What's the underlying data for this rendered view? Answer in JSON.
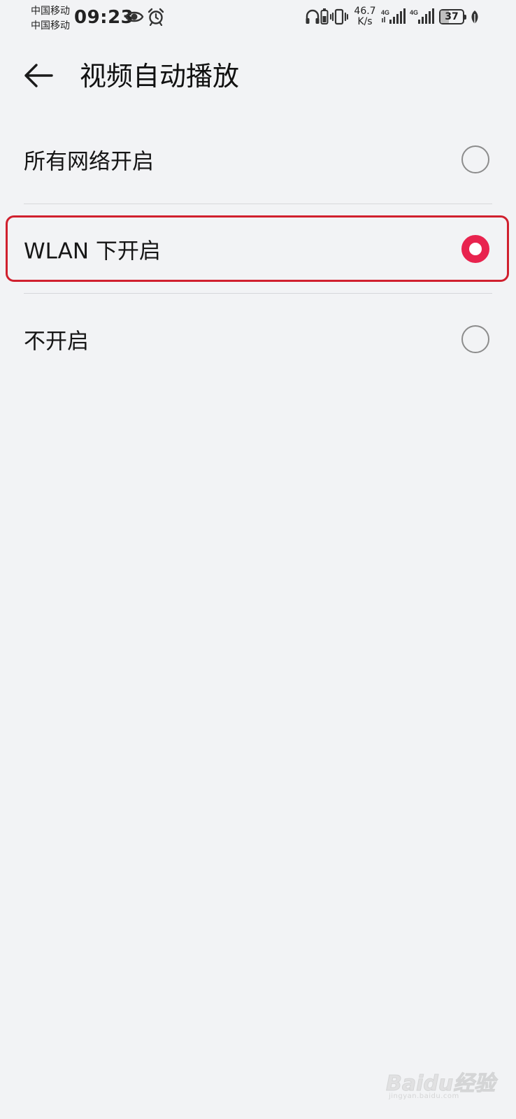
{
  "status_bar": {
    "carrier_1": "中国移动",
    "carrier_2": "中国移动",
    "time": "09:23",
    "net_speed_value": "46.7",
    "net_speed_unit": "K/s",
    "signal_1_label": "4G",
    "signal_2_label": "4G",
    "battery_percent": "37",
    "icons": [
      "eye-icon",
      "alarm-clock-icon",
      "headphones-icon",
      "battery-saver-icon",
      "vibrate-icon",
      "signal-icon",
      "signal-icon",
      "battery-icon",
      "leaf-icon"
    ]
  },
  "header": {
    "back_icon": "arrow-left-icon",
    "title": "视频自动播放"
  },
  "options": [
    {
      "label": "所有网络开启",
      "selected": false
    },
    {
      "label": "WLAN 下开启",
      "selected": true
    },
    {
      "label": "不开启",
      "selected": false
    }
  ],
  "colors": {
    "background": "#f2f3f5",
    "accent": "#e8234e",
    "highlight_frame": "#d0202e",
    "divider": "#d6d7da"
  },
  "watermark": {
    "text": "Baidu经验",
    "subtext": "jingyan.baidu.com"
  }
}
